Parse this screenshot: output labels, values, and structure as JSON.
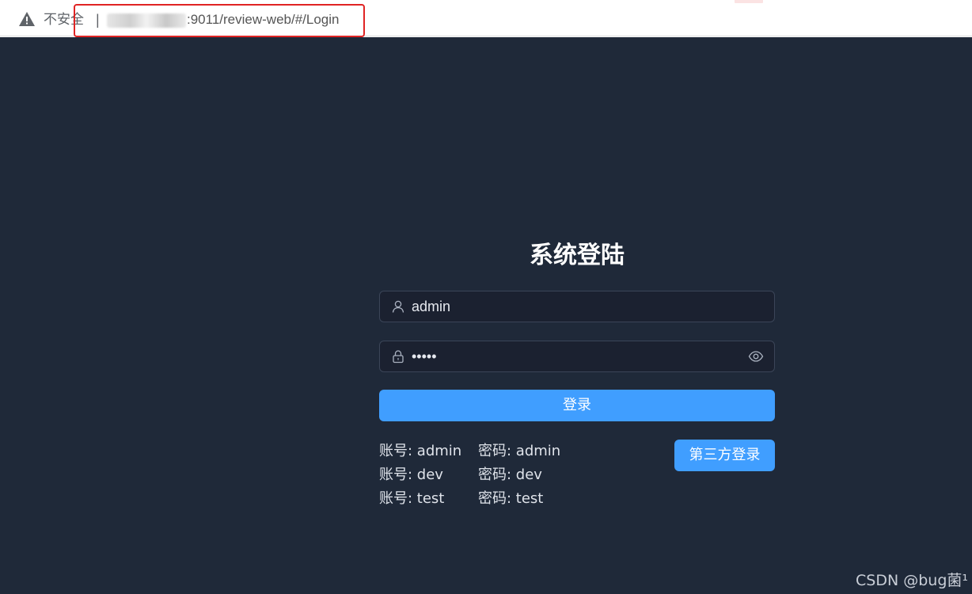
{
  "browser": {
    "security_label": "不安全",
    "separator": "|",
    "url_visible": ":9011/review-web/#/Login"
  },
  "login": {
    "title": "系统登陆",
    "username_value": "admin",
    "password_value": "•••••",
    "login_label": "登录",
    "third_party_label": "第三方登录"
  },
  "credentials": [
    {
      "account": "账号: admin",
      "password": "密码: admin"
    },
    {
      "account": "账号: dev",
      "password": "密码: dev"
    },
    {
      "account": "账号: test",
      "password": "密码: test"
    }
  ],
  "watermark": "CSDN @bug菌¹",
  "colors": {
    "page_bg": "#1f2939",
    "accent": "#409eff",
    "highlight": "#e02424"
  },
  "icons": {
    "security": "warning-triangle-icon",
    "username": "user-icon",
    "password": "lock-icon",
    "toggle": "eye-icon"
  }
}
